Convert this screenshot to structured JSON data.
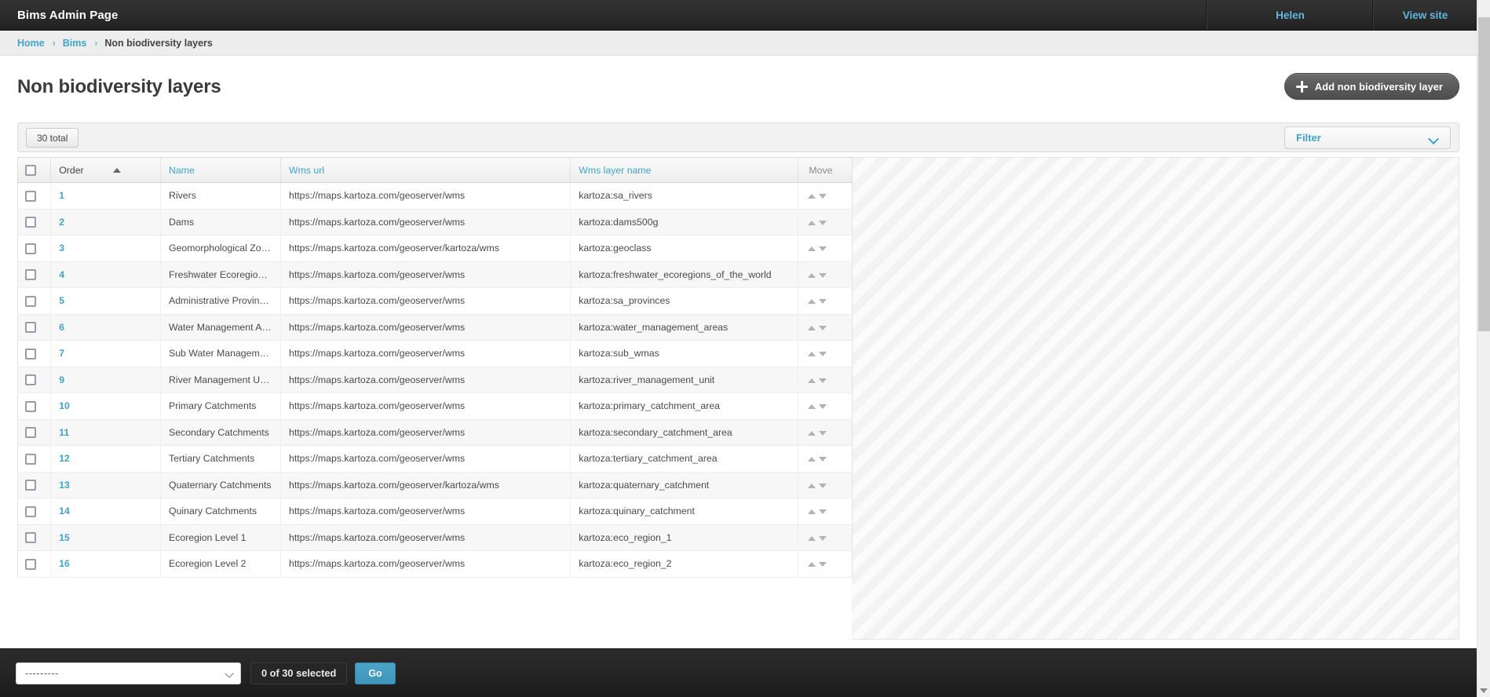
{
  "header": {
    "brand": "Bims Admin Page",
    "user": "Helen",
    "view_site": "View site"
  },
  "breadcrumbs": {
    "home": "Home",
    "section": "Bims",
    "current": "Non biodiversity layers",
    "separator": "›"
  },
  "page": {
    "title": "Non biodiversity layers",
    "add_button": "Add non biodiversity layer"
  },
  "toolbar": {
    "total": "30 total",
    "filter_label": "Filter"
  },
  "table": {
    "columns": {
      "order": "Order",
      "name": "Name",
      "wms_url": "Wms url",
      "wms_layer_name": "Wms layer name",
      "move": "Move"
    },
    "sort": {
      "column": "Order",
      "direction": "ascending"
    },
    "rows": [
      {
        "order": "1",
        "name": "Rivers",
        "wms_url": "https://maps.kartoza.com/geoserver/wms",
        "wms_layer_name": "kartoza:sa_rivers"
      },
      {
        "order": "2",
        "name": "Dams",
        "wms_url": "https://maps.kartoza.com/geoserver/wms",
        "wms_layer_name": "kartoza:dams500g"
      },
      {
        "order": "3",
        "name": "Geomorphological Zones",
        "wms_url": "https://maps.kartoza.com/geoserver/kartoza/wms",
        "wms_layer_name": "kartoza:geoclass"
      },
      {
        "order": "4",
        "name": "Freshwater Ecoregions of the World",
        "wms_url": "https://maps.kartoza.com/geoserver/wms",
        "wms_layer_name": "kartoza:freshwater_ecoregions_of_the_world"
      },
      {
        "order": "5",
        "name": "Administrative Provinces",
        "wms_url": "https://maps.kartoza.com/geoserver/wms",
        "wms_layer_name": "kartoza:sa_provinces"
      },
      {
        "order": "6",
        "name": "Water Management Areas",
        "wms_url": "https://maps.kartoza.com/geoserver/wms",
        "wms_layer_name": "kartoza:water_management_areas"
      },
      {
        "order": "7",
        "name": "Sub Water Management Areas",
        "wms_url": "https://maps.kartoza.com/geoserver/wms",
        "wms_layer_name": "kartoza:sub_wmas"
      },
      {
        "order": "9",
        "name": "River Management Units",
        "wms_url": "https://maps.kartoza.com/geoserver/wms",
        "wms_layer_name": "kartoza:river_management_unit"
      },
      {
        "order": "10",
        "name": "Primary Catchments",
        "wms_url": "https://maps.kartoza.com/geoserver/wms",
        "wms_layer_name": "kartoza:primary_catchment_area"
      },
      {
        "order": "11",
        "name": "Secondary Catchments",
        "wms_url": "https://maps.kartoza.com/geoserver/wms",
        "wms_layer_name": "kartoza:secondary_catchment_area"
      },
      {
        "order": "12",
        "name": "Tertiary Catchments",
        "wms_url": "https://maps.kartoza.com/geoserver/wms",
        "wms_layer_name": "kartoza:tertiary_catchment_area"
      },
      {
        "order": "13",
        "name": "Quaternary Catchments",
        "wms_url": "https://maps.kartoza.com/geoserver/kartoza/wms",
        "wms_layer_name": "kartoza:quaternary_catchment"
      },
      {
        "order": "14",
        "name": "Quinary Catchments",
        "wms_url": "https://maps.kartoza.com/geoserver/wms",
        "wms_layer_name": "kartoza:quinary_catchment"
      },
      {
        "order": "15",
        "name": "Ecoregion Level 1",
        "wms_url": "https://maps.kartoza.com/geoserver/wms",
        "wms_layer_name": "kartoza:eco_region_1"
      },
      {
        "order": "16",
        "name": "Ecoregion Level 2",
        "wms_url": "https://maps.kartoza.com/geoserver/wms",
        "wms_layer_name": "kartoza:eco_region_2"
      }
    ]
  },
  "actionbar": {
    "action_value": "---------",
    "selected_count": "0 of 30 selected",
    "go_label": "Go"
  },
  "colors": {
    "accent": "#3fa4c9",
    "header_bg": "#2b2b2b",
    "go_button": "#4ba3c7"
  }
}
